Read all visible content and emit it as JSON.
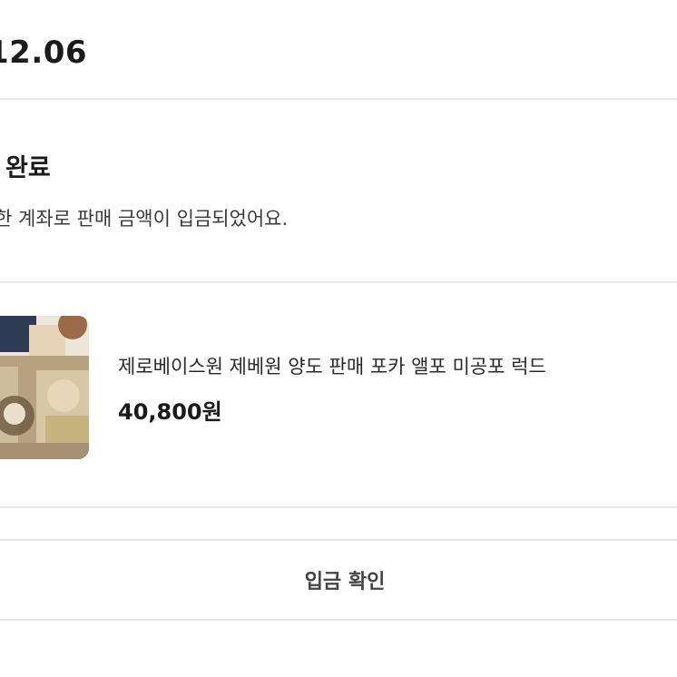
{
  "order": {
    "date": "12.06"
  },
  "status": {
    "title": "완료",
    "description": "한 계좌로 판매 금액이 입금되었어요."
  },
  "product": {
    "name": "제로베이스원 제베원 양도 판매 포카 앨포 미공포 럭드",
    "price": "40,800원"
  },
  "actions": {
    "confirm_label": "입금 확인"
  }
}
